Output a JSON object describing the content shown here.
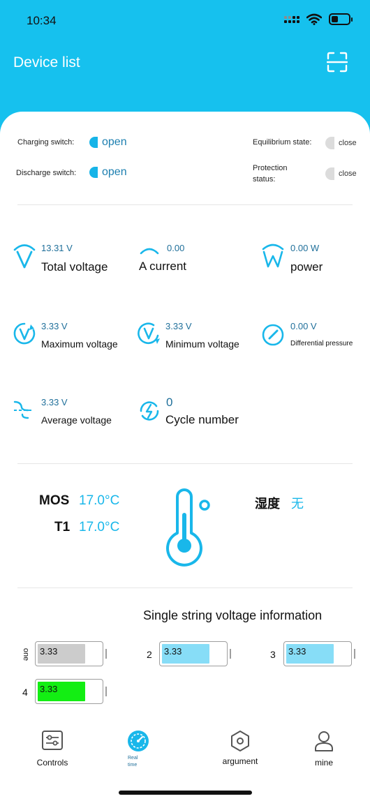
{
  "status_bar": {
    "time": "10:34"
  },
  "header": {
    "title": "Device list",
    "scan_icon": "scan-icon"
  },
  "switches": {
    "charging": {
      "label": "Charging switch:",
      "value": "open"
    },
    "discharge": {
      "label": "Discharge switch:",
      "value": "open"
    },
    "equilibrium": {
      "label": "Equilibrium state:",
      "value": "close"
    },
    "protection": {
      "label_line1": "Protection",
      "label_line2": "status:",
      "value": "close"
    }
  },
  "metrics": {
    "total_voltage": {
      "value": "13.31 V",
      "label": "Total voltage"
    },
    "current": {
      "value": "0.00",
      "label": "A current"
    },
    "power": {
      "value": "0.00 W",
      "label": "power"
    },
    "max_voltage": {
      "value": "3.33 V",
      "label": "Maximum voltage"
    },
    "min_voltage": {
      "value": "3.33 V",
      "label": "Minimum voltage"
    },
    "diff_pressure": {
      "value": "0.00 V",
      "label": "Differential pressure"
    },
    "avg_voltage": {
      "value": "3.33 V",
      "label": "Average voltage"
    },
    "cycle": {
      "value": "0",
      "label": "Cycle number"
    }
  },
  "temperature": {
    "mos": {
      "label": "MOS",
      "value": "17.0°C"
    },
    "t1": {
      "label": "T1",
      "value": "17.0°C"
    },
    "humidity": {
      "label": "湿度",
      "value": "无"
    }
  },
  "cells": {
    "title": "Single string voltage information",
    "items": [
      {
        "index": "one",
        "value": "3.33",
        "color": "#cccccc",
        "level": 0.76
      },
      {
        "index": "2",
        "value": "3.33",
        "color": "#87ddf7",
        "level": 0.76
      },
      {
        "index": "3",
        "value": "3.33",
        "color": "#87ddf7",
        "level": 0.76
      },
      {
        "index": "4",
        "value": "3.33",
        "color": "#13ee13",
        "level": 0.76
      }
    ]
  },
  "tabs": {
    "controls": "Controls",
    "realtime_line1": "Real",
    "realtime_line2": "time",
    "argument": "argument",
    "mine": "mine"
  },
  "colors": {
    "accent": "#16c1ee",
    "value_text": "#1f6f9a",
    "temp_value": "#19b7ea"
  }
}
